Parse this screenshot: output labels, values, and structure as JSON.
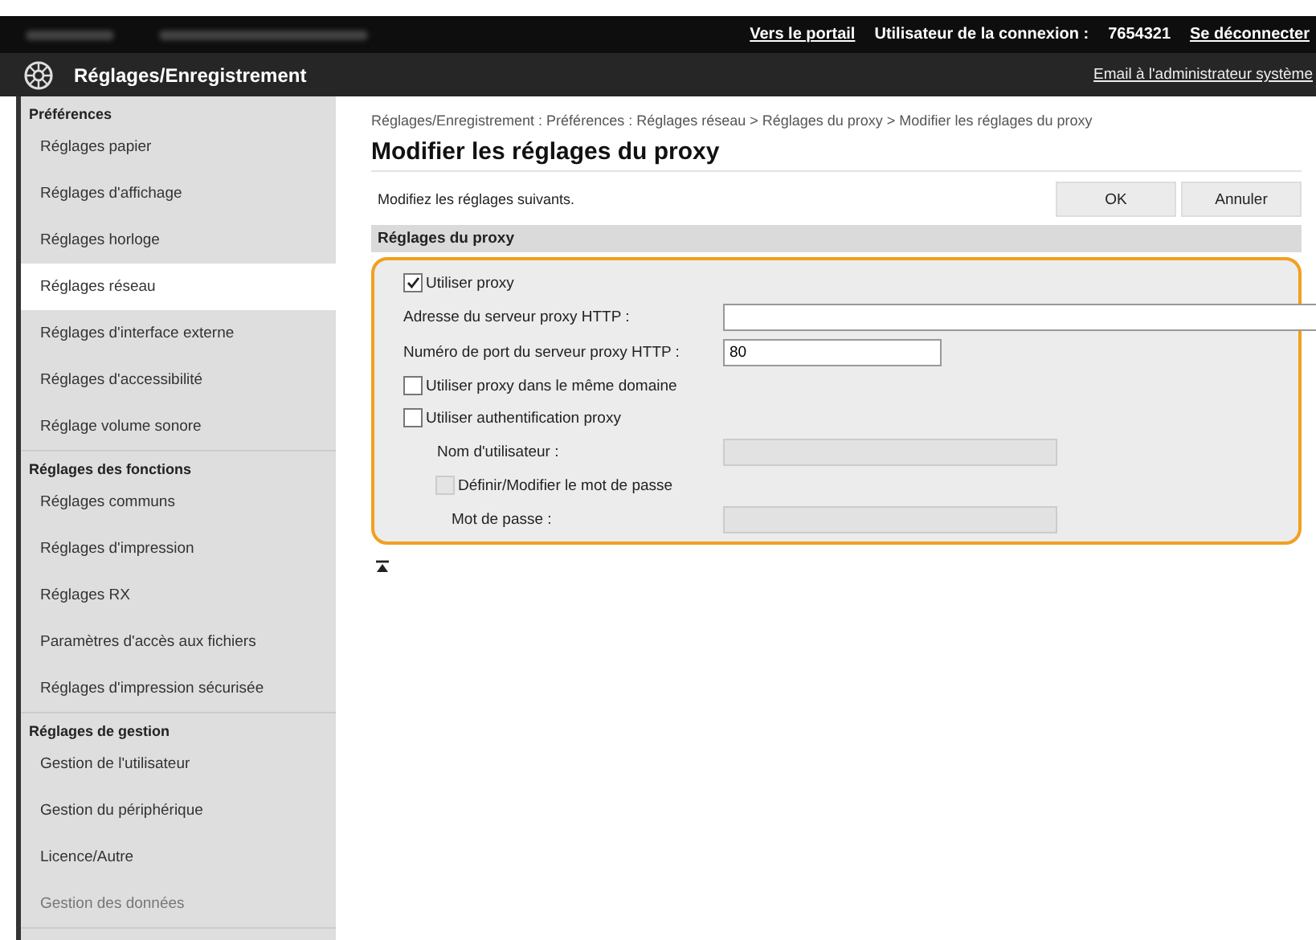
{
  "top_bar": {
    "links": [
      "Vers le portail",
      "Utilisateur de la connexion :",
      "7654321",
      "Se déconnecter"
    ]
  },
  "header": {
    "title": "Réglages/Enregistrement",
    "link": "Email à l'administrateur système"
  },
  "sidebar": {
    "sections": [
      {
        "heading": "Préférences",
        "items": [
          {
            "label": "Réglages papier",
            "selected": false
          },
          {
            "label": "Réglages d'affichage",
            "selected": false
          },
          {
            "label": "Réglages horloge",
            "selected": false
          },
          {
            "label": "Réglages réseau",
            "selected": true
          },
          {
            "label": "Réglages d'interface externe",
            "selected": false
          },
          {
            "label": "Réglages d'accessibilité",
            "selected": false
          },
          {
            "label": "Réglage volume sonore",
            "selected": false
          }
        ]
      },
      {
        "heading": "Réglages des fonctions",
        "items": [
          {
            "label": "Réglages communs",
            "selected": false
          },
          {
            "label": "Réglages d'impression",
            "selected": false
          },
          {
            "label": "Réglages RX",
            "selected": false
          },
          {
            "label": "Paramètres d'accès aux fichiers",
            "selected": false
          },
          {
            "label": "Réglages d'impression sécurisée",
            "selected": false
          }
        ]
      },
      {
        "heading": "Réglages de gestion",
        "items": [
          {
            "label": "Gestion de l'utilisateur",
            "selected": false
          },
          {
            "label": "Gestion du périphérique",
            "selected": false
          },
          {
            "label": "Licence/Autre",
            "selected": false
          },
          {
            "label": "Gestion des données",
            "selected": false
          }
        ]
      }
    ]
  },
  "breadcrumb": "Réglages/Enregistrement : Préférences : Réglages réseau > Réglages du proxy > Modifier les réglages du proxy",
  "page_title": "Modifier les réglages du proxy",
  "instruction": "Modifiez les réglages suivants.",
  "buttons": [
    "OK",
    "Annuler"
  ],
  "section": {
    "title": "Réglages du proxy",
    "rows": [
      {
        "kind": "checkbox",
        "label": "Utiliser proxy",
        "checked": true,
        "disabled": false
      },
      {
        "kind": "text",
        "label": "Adresse du serveur proxy HTTP :",
        "disabled": false
      },
      {
        "kind": "text",
        "label": "Numéro de port du serveur proxy HTTP :",
        "value": "80",
        "disabled": false
      },
      {
        "kind": "checkbox",
        "label": "Utiliser proxy dans le même domaine",
        "checked": false,
        "disabled": false
      },
      {
        "kind": "checkbox",
        "label": "Utiliser authentification proxy",
        "checked": false,
        "disabled": false,
        "children": [
          {
            "kind": "text",
            "label": "Nom d'utilisateur :",
            "disabled": true
          },
          {
            "kind": "checkbox",
            "label": "Définir/Modifier le mot de passe",
            "checked": false,
            "disabled": true,
            "children": [
              {
                "kind": "text",
                "label": "Mot de passe :",
                "disabled": true
              }
            ]
          }
        ]
      }
    ]
  }
}
